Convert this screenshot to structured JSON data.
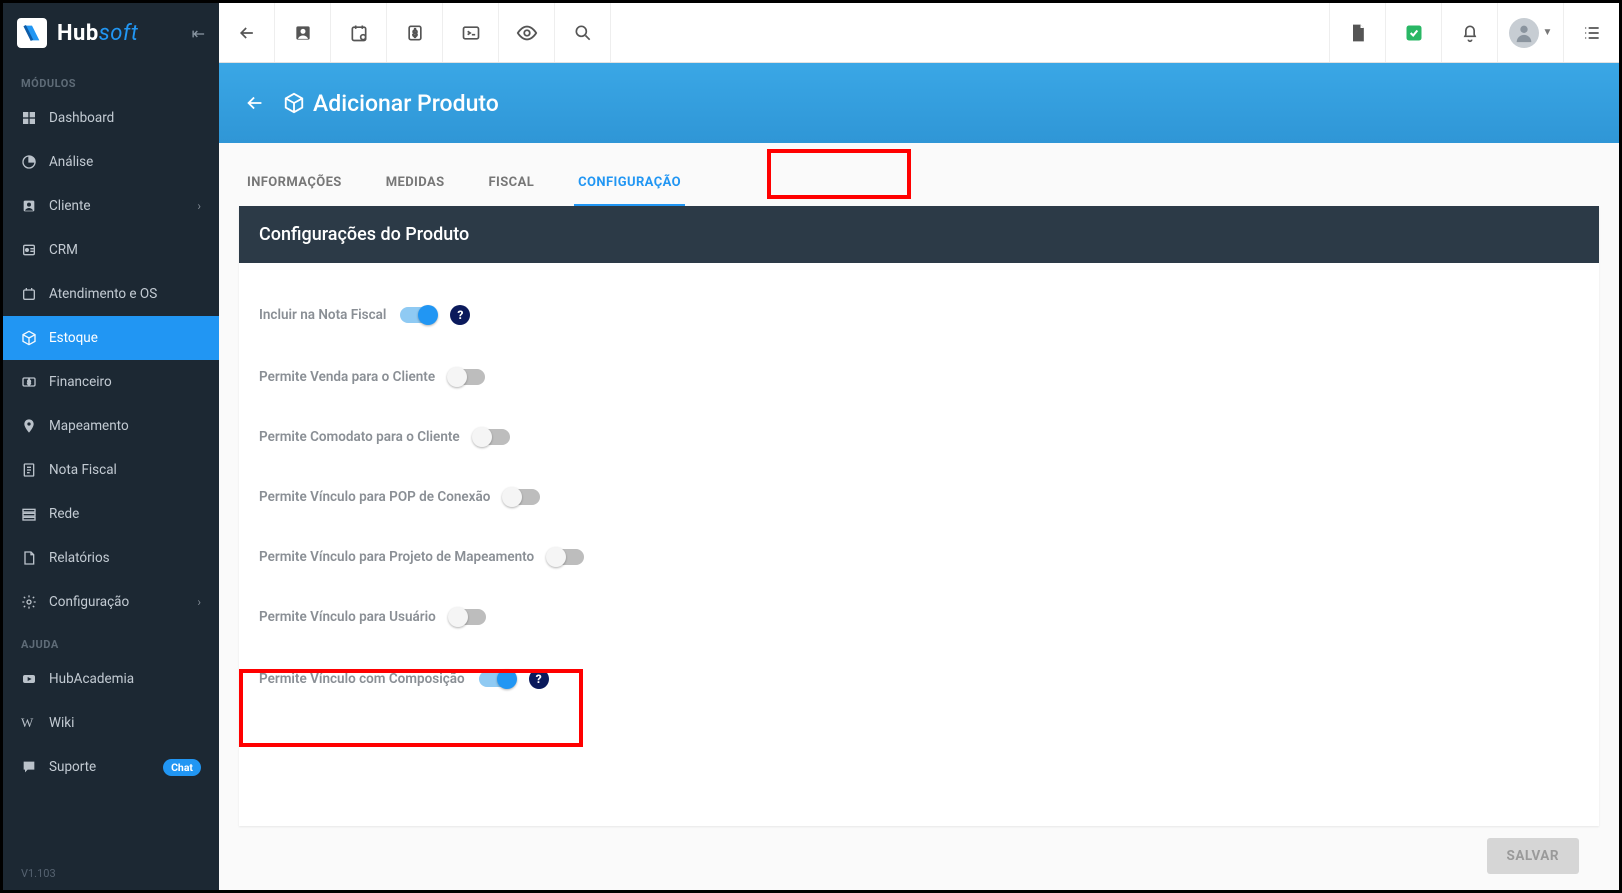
{
  "brand": {
    "name_bold": "Hub",
    "name_soft": "soft"
  },
  "sidebar": {
    "section1": "MÓDULOS",
    "section2": "AJUDA",
    "items": [
      {
        "label": "Dashboard"
      },
      {
        "label": "Análise"
      },
      {
        "label": "Cliente"
      },
      {
        "label": "CRM"
      },
      {
        "label": "Atendimento e OS"
      },
      {
        "label": "Estoque"
      },
      {
        "label": "Financeiro"
      },
      {
        "label": "Mapeamento"
      },
      {
        "label": "Nota Fiscal"
      },
      {
        "label": "Rede"
      },
      {
        "label": "Relatórios"
      },
      {
        "label": "Configuração"
      }
    ],
    "help": [
      {
        "label": "HubAcademia"
      },
      {
        "label": "Wiki"
      },
      {
        "label": "Suporte",
        "badge": "Chat"
      }
    ],
    "version": "V1.103"
  },
  "page": {
    "title": "Adicionar Produto"
  },
  "tabs": {
    "t0": "INFORMAÇÕES",
    "t1": "MEDIDAS",
    "t2": "FISCAL",
    "t3": "CONFIGURAÇÃO"
  },
  "card": {
    "title": "Configurações do Produto"
  },
  "config": {
    "r0": "Incluir na Nota Fiscal",
    "r1": "Permite Venda para o Cliente",
    "r2": "Permite Comodato para o Cliente",
    "r3": "Permite Vínculo para POP de Conexão",
    "r4": "Permite Vínculo para Projeto de Mapeamento",
    "r5": "Permite Vínculo para Usuário",
    "r6": "Permite Vínculo com Composição"
  },
  "buttons": {
    "save": "SALVAR"
  }
}
